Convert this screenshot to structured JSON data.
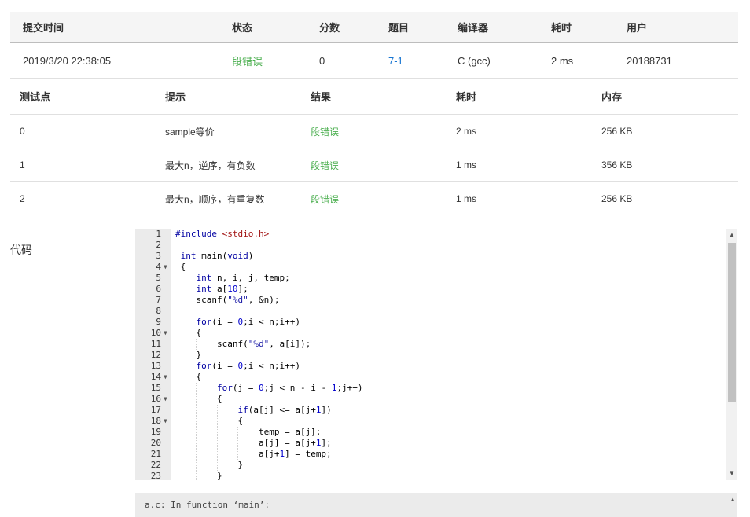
{
  "submission": {
    "headers": {
      "time": "提交时间",
      "status": "状态",
      "score": "分数",
      "problem": "题目",
      "compiler": "编译器",
      "elapsed": "耗时",
      "user": "用户"
    },
    "row": {
      "time": "2019/3/20 22:38:05",
      "status": "段错误",
      "score": "0",
      "problem": "7-1",
      "compiler": "C (gcc)",
      "elapsed": "2 ms",
      "user": "20188731"
    }
  },
  "cases": {
    "headers": {
      "id": "测试点",
      "hint": "提示",
      "result": "结果",
      "elapsed": "耗时",
      "memory": "内存"
    },
    "rows": [
      {
        "id": "0",
        "hint": "sample等价",
        "result": "段错误",
        "elapsed": "2 ms",
        "memory": "256 KB"
      },
      {
        "id": "1",
        "hint": "最大n，逆序，有负数",
        "result": "段错误",
        "elapsed": "1 ms",
        "memory": "356 KB"
      },
      {
        "id": "2",
        "hint": "最大n，顺序，有重复数",
        "result": "段错误",
        "elapsed": "1 ms",
        "memory": "256 KB"
      }
    ]
  },
  "code_label": "代码",
  "code_lines": [
    {
      "n": "1",
      "fold": false,
      "text": "#include <stdio.h>"
    },
    {
      "n": "2",
      "fold": false,
      "text": ""
    },
    {
      "n": "3",
      "fold": false,
      "text": " int main(void)"
    },
    {
      "n": "4",
      "fold": true,
      "text": " {"
    },
    {
      "n": "5",
      "fold": false,
      "text": "    int n, i, j, temp;"
    },
    {
      "n": "6",
      "fold": false,
      "text": "    int a[10];"
    },
    {
      "n": "7",
      "fold": false,
      "text": "    scanf(\"%d\", &n);"
    },
    {
      "n": "8",
      "fold": false,
      "text": ""
    },
    {
      "n": "9",
      "fold": false,
      "text": "    for(i = 0;i < n;i++)"
    },
    {
      "n": "10",
      "fold": true,
      "text": "    {"
    },
    {
      "n": "11",
      "fold": false,
      "text": "        scanf(\"%d\", a[i]);"
    },
    {
      "n": "12",
      "fold": false,
      "text": "    }"
    },
    {
      "n": "13",
      "fold": false,
      "text": "    for(i = 0;i < n;i++)"
    },
    {
      "n": "14",
      "fold": true,
      "text": "    {"
    },
    {
      "n": "15",
      "fold": false,
      "text": "        for(j = 0;j < n - i - 1;j++)"
    },
    {
      "n": "16",
      "fold": true,
      "text": "        {"
    },
    {
      "n": "17",
      "fold": false,
      "text": "            if(a[j] <= a[j+1])"
    },
    {
      "n": "18",
      "fold": true,
      "text": "            {"
    },
    {
      "n": "19",
      "fold": false,
      "text": "                temp = a[j];"
    },
    {
      "n": "20",
      "fold": false,
      "text": "                a[j] = a[j+1];"
    },
    {
      "n": "21",
      "fold": false,
      "text": "                a[j+1] = temp;"
    },
    {
      "n": "22",
      "fold": false,
      "text": "            }"
    },
    {
      "n": "23",
      "fold": false,
      "text": "        }"
    }
  ],
  "compile_output": "a.c: In function ‘main’:",
  "colors": {
    "status_error": "#4caf50",
    "problem_link": "#1976d2",
    "gutter_bg": "#ebebeb"
  }
}
